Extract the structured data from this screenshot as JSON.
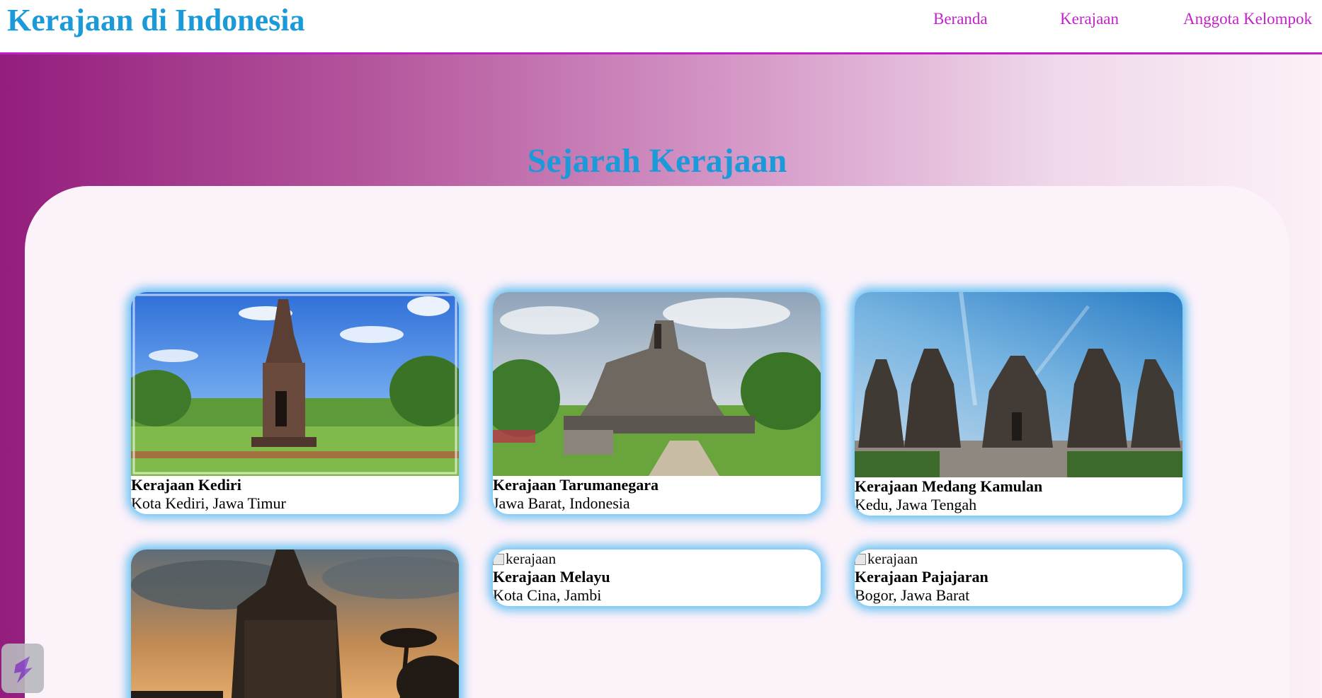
{
  "header": {
    "brand": "Kerajaan di Indonesia",
    "nav": [
      "Beranda",
      "Kerajaan",
      "Anggota Kelompok"
    ]
  },
  "main": {
    "title": "Sejarah Kerajaan",
    "cards": [
      {
        "name": "Kerajaan Kediri",
        "location": "Kota Kediri, Jawa Timur",
        "image_alt": ""
      },
      {
        "name": "Kerajaan Tarumanegara",
        "location": "Jawa Barat, Indonesia",
        "image_alt": ""
      },
      {
        "name": "Kerajaan Medang Kamulan",
        "location": "Kedu, Jawa Tengah",
        "image_alt": ""
      },
      {
        "name": "",
        "location": "",
        "image_alt": ""
      },
      {
        "name": "Kerajaan Melayu",
        "location": "Kota Cina, Jambi",
        "image_alt": "kerajaan"
      },
      {
        "name": "Kerajaan Pajajaran",
        "location": "Bogor, Jawa Barat",
        "image_alt": "kerajaan"
      }
    ]
  },
  "colors": {
    "brand": "#1a9ad8",
    "nav": "#c222c9",
    "card_glow": "#34b2f0",
    "gradient_start": "#931d7d",
    "gradient_end": "#fcf1f8"
  }
}
